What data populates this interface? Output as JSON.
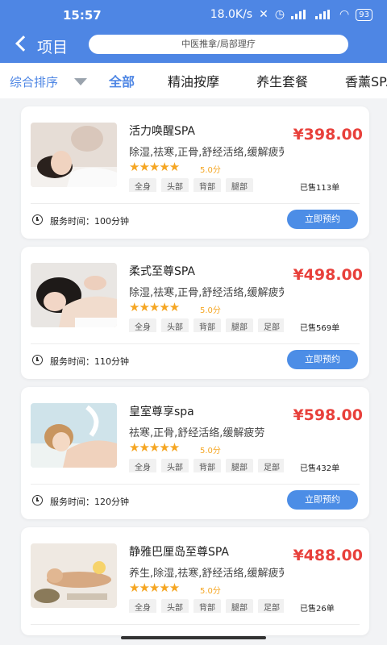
{
  "status": {
    "time": "15:57",
    "speed": "18.0K/s",
    "battery": "93"
  },
  "header": {
    "title": "项目",
    "search_text": "中医推拿/局部理疗"
  },
  "filter": {
    "sort_label": "综合排序",
    "tabs": [
      "全部",
      "精油按摩",
      "养生套餐",
      "香薰SPA"
    ]
  },
  "products": [
    {
      "name": "活力唤醒SPA",
      "desc": "除湿,祛寒,正骨,舒经活络,缓解疲劳",
      "stars": "★★★★★",
      "rating": "5.0分",
      "tags": [
        "全身",
        "头部",
        "背部",
        "腿部"
      ],
      "price": "¥398.00",
      "sold": "已售113单",
      "duration": "服务时间：100分钟",
      "book": "立即预约"
    },
    {
      "name": "柔式至尊SPA",
      "desc": "除湿,祛寒,正骨,舒经活络,缓解疲劳",
      "stars": "★★★★★",
      "rating": "5.0分",
      "tags": [
        "全身",
        "头部",
        "背部",
        "腿部",
        "足部"
      ],
      "price": "¥498.00",
      "sold": "已售569单",
      "duration": "服务时间：110分钟",
      "book": "立即预约"
    },
    {
      "name": "皇室尊享spa",
      "desc": "祛寒,正骨,舒经活络,缓解疲劳",
      "stars": "★★★★★",
      "rating": "5.0分",
      "tags": [
        "全身",
        "头部",
        "背部",
        "腿部",
        "足部"
      ],
      "price": "¥598.00",
      "sold": "已售432单",
      "duration": "服务时间：120分钟",
      "book": "立即预约"
    },
    {
      "name": "静雅巴厘岛至尊SPA",
      "desc": "养生,除湿,祛寒,舒经活络,缓解疲劳",
      "stars": "★★★★★",
      "rating": "5.0分",
      "tags": [
        "全身",
        "头部",
        "背部",
        "腿部",
        "足部"
      ],
      "price": "¥488.00",
      "sold": "已售26单",
      "duration": "",
      "book": ""
    }
  ]
}
